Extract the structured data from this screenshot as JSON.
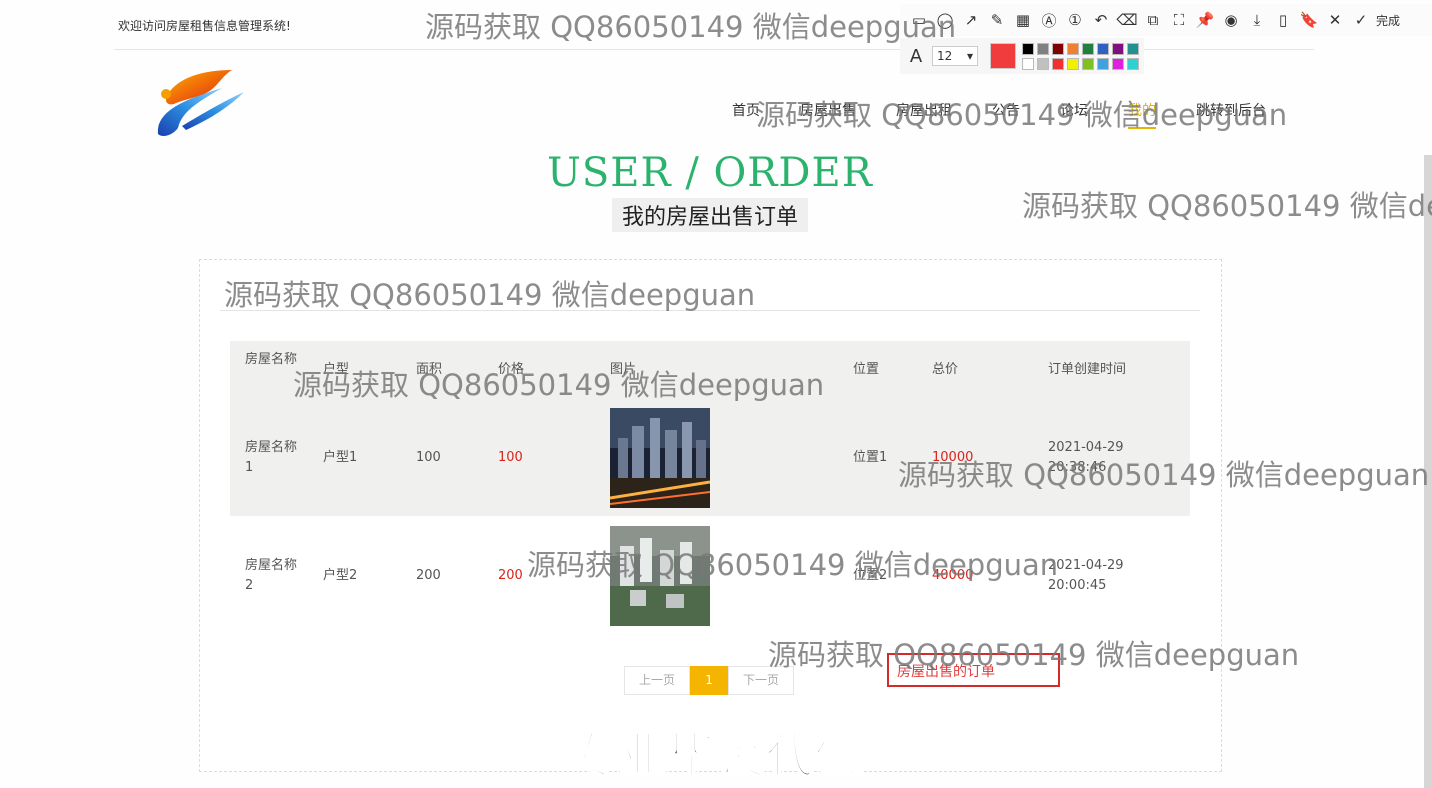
{
  "header": {
    "welcome": "欢迎访问房屋租售信息管理系统!",
    "nav": [
      {
        "label": "首页"
      },
      {
        "label": "房屋出售"
      },
      {
        "label": "房屋出租"
      },
      {
        "label": "公告"
      },
      {
        "label": "论坛"
      },
      {
        "label": "我的"
      },
      {
        "label": "跳转到后台"
      }
    ],
    "active_nav": "我的",
    "accent_color": "#e3b400"
  },
  "page_heading": {
    "en": "USER / ORDER",
    "cn": "我的房屋出售订单",
    "en_color": "#2bb26d"
  },
  "table": {
    "columns": [
      "房屋名称",
      "户型",
      "面积",
      "价格",
      "图片",
      "位置",
      "总价",
      "订单创建时间"
    ],
    "rows": [
      {
        "name": "房屋名称1",
        "type": "户型1",
        "area": "100",
        "price": "100",
        "image": "night-city-buildings",
        "location": "位置1",
        "total": "10000",
        "created": "2021-04-29 20:38:46"
      },
      {
        "name": "房屋名称2",
        "type": "户型2",
        "area": "200",
        "price": "200",
        "image": "aerial-residential-complex",
        "location": "位置2",
        "total": "40000",
        "created": "2021-04-29 20:00:45"
      }
    ],
    "price_color": "#d9241b"
  },
  "pagination": {
    "prev": "上一页",
    "current": "1",
    "next": "下一页",
    "current_color": "#f5b400"
  },
  "annotation": {
    "text": "房屋出售的订单",
    "color": "#d42a2a"
  },
  "screenshot_toolbar": {
    "done_label": "完成",
    "font_size": "12",
    "current_color": "#f03c3c",
    "palette": [
      "#000000",
      "#808080",
      "#800000",
      "#f08030",
      "#208040",
      "#3060c0",
      "#801080",
      "#209090",
      "#ffffff",
      "#c0c0c0",
      "#f03030",
      "#f0f000",
      "#80c020",
      "#40a0e0",
      "#e020e0",
      "#30d0d0"
    ]
  },
  "watermarks": {
    "text": "源码获取 QQ86050149 微信deepguan",
    "footer_overlay": "专业毕设代做"
  }
}
